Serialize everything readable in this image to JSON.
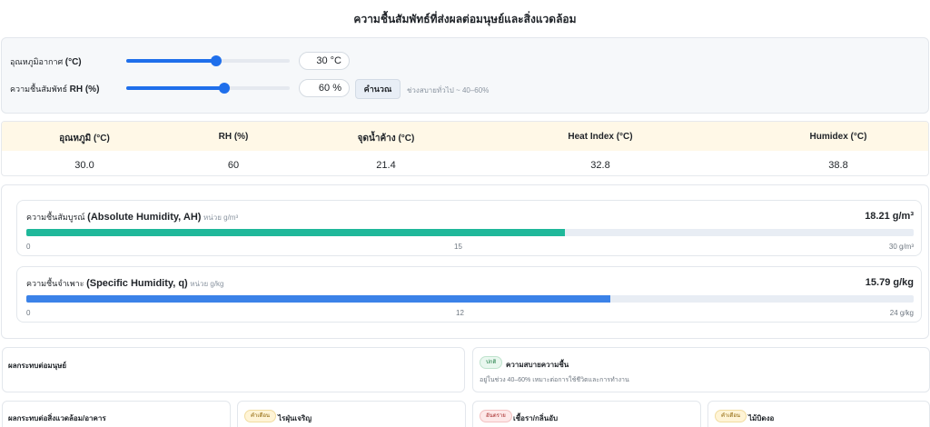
{
  "page": {
    "title": "ความชื้นสัมพัทธ์ที่ส่งผลต่อมนุษย์และสิ่งแวดล้อม"
  },
  "controls": {
    "temp": {
      "label": "อุณหภูมิอากาศ",
      "label_unit": "(°C)",
      "value_text": "30 °C",
      "level": 0.55
    },
    "rh": {
      "label": "ความชื้นสัมพัทธ์",
      "label_unit": "RH (%)",
      "value_text": "60 %",
      "level": 0.6
    },
    "calc_label": "คำนวณ",
    "hint": "ช่วงสบายทั่วไป ~ 40–60%"
  },
  "summary": {
    "headers": {
      "temp": "อุณหภูมิ (°C)",
      "rh": "RH (%)",
      "dew": "จุดน้ำค้าง (°C)",
      "hi": "Heat Index (°C)",
      "humidex": "Humidex (°C)"
    },
    "values": {
      "temp": "30.0",
      "rh": "60",
      "dew": "21.4",
      "hi": "32.8",
      "humidex": "38.8"
    }
  },
  "gauges": {
    "ah": {
      "title_th": "ความชื้นสัมบูรณ์",
      "title_en": "(Absolute Humidity, AH)",
      "unit": "หน่วย g/m³",
      "value_text": "18.21 g/m³",
      "value": 18.21,
      "max": 30,
      "tick_min": "0",
      "tick_mid": "15",
      "tick_max": "30 g/m³",
      "color": "#1fb89a"
    },
    "sh": {
      "title_th": "ความชื้นจำเพาะ",
      "title_en": "(Specific Humidity, q)",
      "unit": "หน่วย g/kg",
      "value_text": "15.79 g/kg",
      "value": 15.79,
      "max": 24,
      "tick_min": "0",
      "tick_mid": "12",
      "tick_max": "24 g/kg",
      "color": "#3b82e8"
    }
  },
  "impacts": {
    "human_title": "ผลกระทบต่อมนุษย์",
    "comfort": {
      "badge": "ปกติ",
      "title": "ความสบายความชื้น",
      "desc": "อยู่ในช่วง 40–60% เหมาะต่อการใช้ชีวิตและการทำงาน"
    },
    "env_title": "ผลกระทบต่อสิ่งแวดล้อม/อาคาร",
    "dust": {
      "badge": "คำเตือน",
      "title": "ไรฝุ่นเจริญ"
    },
    "mold": {
      "badge": "อันตราย",
      "title": "เชื้อรา/กลิ่นอับ"
    },
    "wood": {
      "badge": "คำเตือน",
      "title": "ไม้บิดงอ"
    }
  }
}
